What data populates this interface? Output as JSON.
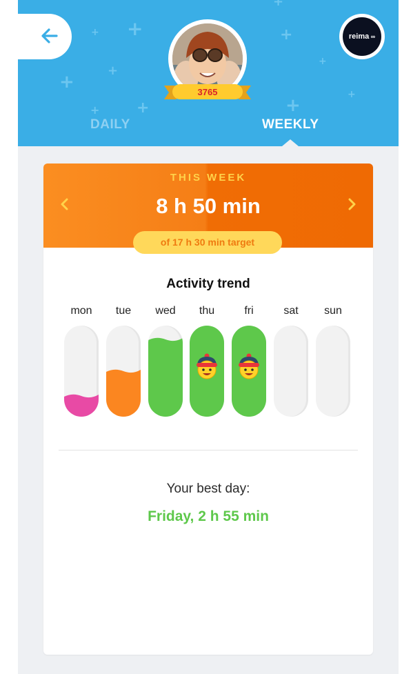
{
  "header": {
    "score": "3765",
    "brand": "reima",
    "tabs": {
      "daily": "DAILY",
      "weekly": "WEEKLY",
      "active": "weekly"
    },
    "colors": {
      "background": "#3aaee6",
      "tab_inactive": "#8ed0f2",
      "tab_active": "#ffffff"
    }
  },
  "summary": {
    "label": "THIS WEEK",
    "total": "8 h 50 min",
    "target": "of 17 h 30 min target",
    "prev_icon": "chevron-left-icon",
    "next_icon": "chevron-right-icon",
    "colors": {
      "header_left": "#fb8e21",
      "header_right": "#f06d05",
      "label": "#ffd34a",
      "pill": "#ffd85a"
    }
  },
  "trend": {
    "title": "Activity trend",
    "days": [
      {
        "label": "mon",
        "level": 0.2,
        "color": "#e84aa5",
        "goal_reached": false
      },
      {
        "label": "tue",
        "level": 0.47,
        "color": "#fb8620",
        "goal_reached": false
      },
      {
        "label": "wed",
        "level": 0.82,
        "color": "#5ec84b",
        "goal_reached": false
      },
      {
        "label": "thu",
        "level": 1.0,
        "color": "#5ec84b",
        "goal_reached": true
      },
      {
        "label": "fri",
        "level": 1.0,
        "color": "#5ec84b",
        "goal_reached": true
      },
      {
        "label": "sat",
        "level": 0,
        "color": "#f2f2f2",
        "goal_reached": false
      },
      {
        "label": "sun",
        "level": 0,
        "color": "#f2f2f2",
        "goal_reached": false
      }
    ]
  },
  "best_day": {
    "label": "Your best day:",
    "value": "Friday, 2 h 55 min"
  }
}
